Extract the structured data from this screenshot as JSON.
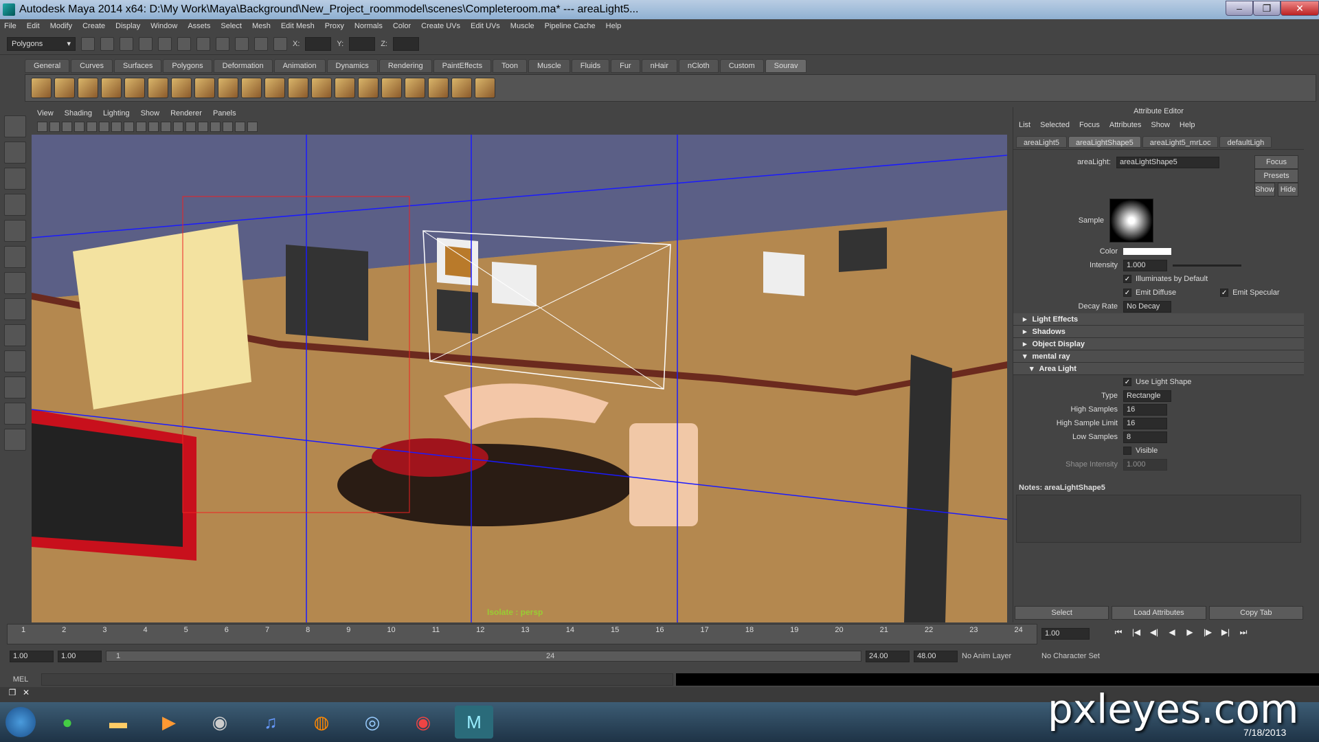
{
  "window": {
    "title": "Autodesk Maya 2014 x64: D:\\My Work\\Maya\\Background\\New_Project_roommodel\\scenes\\Completeroom.ma*   ---   areaLight5..."
  },
  "menubar": [
    "File",
    "Edit",
    "Modify",
    "Create",
    "Display",
    "Window",
    "Assets",
    "Select",
    "Mesh",
    "Edit Mesh",
    "Proxy",
    "Normals",
    "Color",
    "Create UVs",
    "Edit UVs",
    "Muscle",
    "Pipeline Cache",
    "Help"
  ],
  "statusline": {
    "menuset": "Polygons",
    "x_label": "X:",
    "y_label": "Y:",
    "z_label": "Z:"
  },
  "shelf_tabs": [
    "General",
    "Curves",
    "Surfaces",
    "Polygons",
    "Deformation",
    "Animation",
    "Dynamics",
    "Rendering",
    "PaintEffects",
    "Toon",
    "Muscle",
    "Fluids",
    "Fur",
    "nHair",
    "nCloth",
    "Custom",
    "Sourav"
  ],
  "viewport": {
    "menu": [
      "View",
      "Shading",
      "Lighting",
      "Show",
      "Renderer",
      "Panels"
    ],
    "hud": "Isolate : persp"
  },
  "attribute_editor": {
    "header": "Attribute Editor",
    "menu": [
      "List",
      "Selected",
      "Focus",
      "Attributes",
      "Show",
      "Help"
    ],
    "tabs": [
      "areaLight5",
      "areaLightShape5",
      "areaLight5_mrLoc",
      "defaultLigh"
    ],
    "type_label": "areaLight:",
    "node_name": "areaLightShape5",
    "buttons": {
      "focus": "Focus",
      "presets": "Presets",
      "show": "Show",
      "hide": "Hide"
    },
    "sample_label": "Sample",
    "color_label": "Color",
    "intensity_label": "Intensity",
    "intensity": "1.000",
    "illuminates": "Illuminates by Default",
    "emit_diffuse": "Emit Diffuse",
    "emit_specular": "Emit Specular",
    "decay_label": "Decay Rate",
    "decay": "No Decay",
    "sections": [
      "Light Effects",
      "Shadows",
      "Object Display",
      "mental ray"
    ],
    "area_light": {
      "title": "Area Light",
      "use_shape": "Use Light Shape",
      "type_label": "Type",
      "type": "Rectangle",
      "high_samples_label": "High Samples",
      "high_samples": "16",
      "high_limit_label": "High Sample Limit",
      "high_limit": "16",
      "low_samples_label": "Low Samples",
      "low_samples": "8",
      "visible": "Visible",
      "shape_intensity_label": "Shape Intensity",
      "shape_intensity": "1.000"
    },
    "notes": "Notes:  areaLightShape5",
    "bottom": {
      "select": "Select",
      "load": "Load Attributes",
      "copy": "Copy Tab"
    }
  },
  "timeline": {
    "ticks": [
      "1",
      "2",
      "3",
      "4",
      "5",
      "6",
      "7",
      "8",
      "9",
      "10",
      "11",
      "12",
      "13",
      "14",
      "15",
      "16",
      "17",
      "18",
      "19",
      "20",
      "21",
      "22",
      "23",
      "24"
    ],
    "current": "1.00"
  },
  "range": {
    "start": "1.00",
    "start2": "1.00",
    "slider_start": "1",
    "slider_end": "24",
    "end": "24.00",
    "end2": "48.00",
    "anim_layer": "No Anim Layer",
    "char_set": "No Character Set"
  },
  "cmd": {
    "label": "MEL"
  },
  "taskbar": {
    "date": "7/18/2013"
  },
  "watermark": "pxleyes.com"
}
